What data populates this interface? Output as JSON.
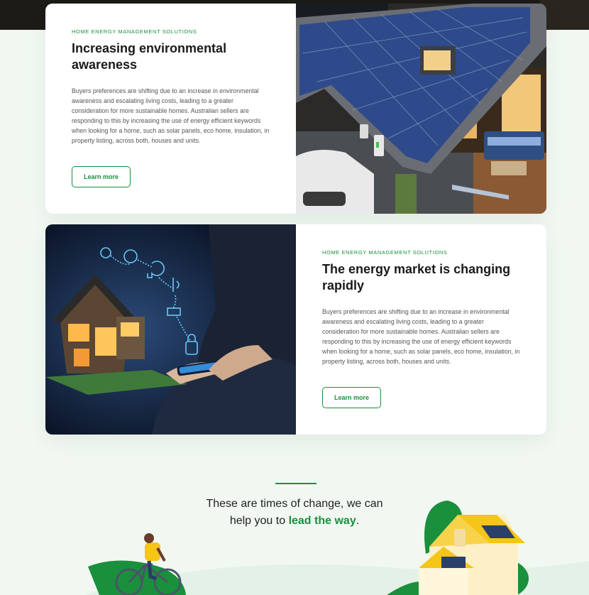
{
  "cards": [
    {
      "eyebrow": "HOME ENERGY MANAGEMENT SOLUTIONS",
      "title": "Increasing environmental awareness",
      "body": "Buyers preferences are shifting due to an increase in environmental awareness and escalating living costs, leading to a greater consideration for more sustainable homes. Australian sellers are responding to this by increasing the use of energy efficient keywords when looking for a home, such as solar panels, eco home, insulation, in property listing, across both, houses and units.",
      "button": "Learn more",
      "image": "solar-house-photo"
    },
    {
      "eyebrow": "HOME ENERGY MANAGEMENT SOLUTIONS",
      "title": "The energy market is changing rapidly",
      "body": "Buyers preferences are shifting due to an increase in environmental awareness and escalating living costs, leading to a greater consideration for more sustainable homes. Australian sellers are responding to this by increasing the use of energy efficient keywords when looking for a home, such as solar panels, eco home, insulation, in property listing, across both, houses and units.",
      "button": "Learn more",
      "image": "smart-home-phone-photo"
    }
  ],
  "tagline": {
    "line1": "These are times of change, we can",
    "line2_prefix": "help you to ",
    "highlight": "lead the way",
    "suffix": "."
  },
  "colors": {
    "accent": "#1a8f3c",
    "background": "#f1f8f2"
  }
}
